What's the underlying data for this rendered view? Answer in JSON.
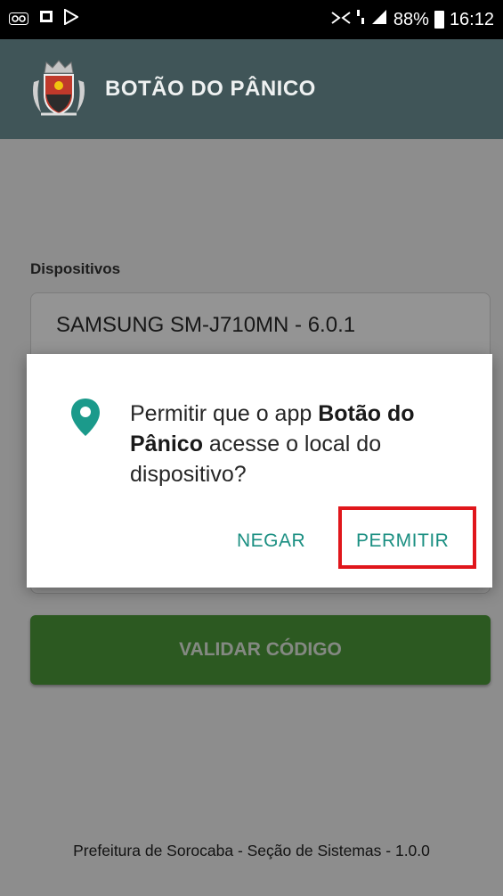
{
  "status_bar": {
    "left_icons": [
      "voicemail-icon",
      "app-crest-icon",
      "play-store-icon"
    ],
    "right_icons": [
      "nfc-icon",
      "data-icon",
      "signal-icon"
    ],
    "battery": "88%",
    "time": "16:12"
  },
  "app_bar": {
    "title": "BOTÃO DO PÂNICO",
    "logo": "city-crest-icon"
  },
  "form": {
    "devices_label": "Dispositivos",
    "device_value": "SAMSUNG SM-J710MN - 6.0.1",
    "validate_label": "VALIDAR CÓDIGO"
  },
  "dialog": {
    "icon": "location-pin-icon",
    "message_prefix": "Permitir que o app ",
    "app_name": "Botão do Pânico",
    "message_suffix": " acesse o local do dispositivo?",
    "deny_label": "NEGAR",
    "allow_label": "PERMITIR"
  },
  "footer": {
    "text": "Prefeitura de Sorocaba - Seção de Sistemas - 1.0.0"
  },
  "colors": {
    "app_bar": "#405558",
    "accent": "#1b8f82",
    "button_green": "#4c9a3a",
    "highlight_red": "#e0161b"
  }
}
